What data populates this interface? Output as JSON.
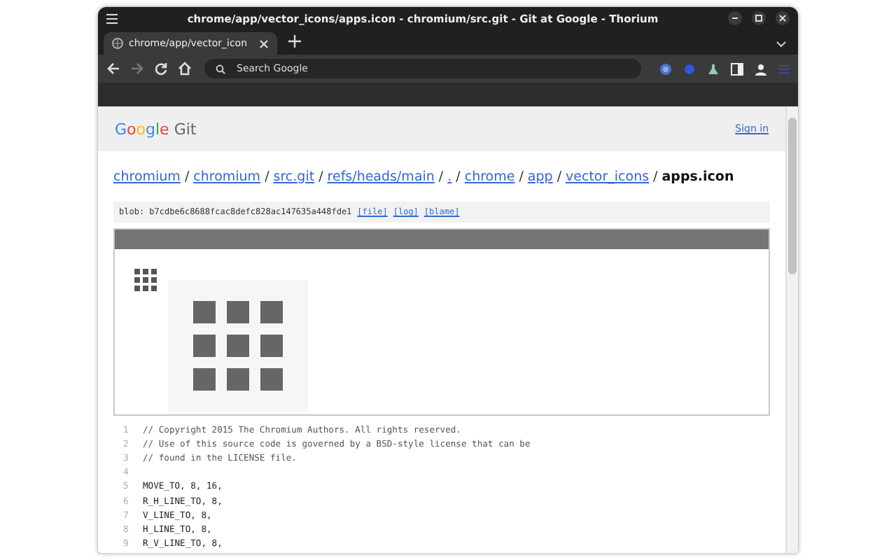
{
  "window": {
    "title": "chrome/app/vector_icons/apps.icon - chromium/src.git - Git at Google - Thorium"
  },
  "tabs": [
    {
      "label": "chrome/app/vector_icon",
      "selected": true
    }
  ],
  "nav_buttons": [
    {
      "kind": "back",
      "disabled": false
    },
    {
      "kind": "forward",
      "disabled": true
    },
    {
      "kind": "reload",
      "disabled": false
    },
    {
      "kind": "home",
      "disabled": false
    }
  ],
  "omnibox": {
    "placeholder": "Search Google"
  },
  "site": {
    "logo": "Google",
    "product": "Git",
    "sign_in": "Sign in"
  },
  "breadcrumb": [
    {
      "kind": "link",
      "label": "chromium"
    },
    {
      "kind": "separator",
      "label": "/"
    },
    {
      "kind": "link",
      "label": "chromium"
    },
    {
      "kind": "separator",
      "label": "/"
    },
    {
      "kind": "link",
      "label": "src.git"
    },
    {
      "kind": "separator",
      "label": "/"
    },
    {
      "kind": "link",
      "label": "refs/heads/main"
    },
    {
      "kind": "separator",
      "label": "/"
    },
    {
      "kind": "link",
      "label": "."
    },
    {
      "kind": "separator",
      "label": "/"
    },
    {
      "kind": "link",
      "label": "chrome"
    },
    {
      "kind": "separator",
      "label": "/"
    },
    {
      "kind": "link",
      "label": "app"
    },
    {
      "kind": "separator",
      "label": "/"
    },
    {
      "kind": "link",
      "label": "vector_icons"
    },
    {
      "kind": "separator",
      "label": "/"
    },
    {
      "kind": "current",
      "label": "apps.icon"
    }
  ],
  "blob": {
    "label": "blob: b7cdbe6c8688fcac8defc828ac147635a448fde1",
    "links": [
      "[file]",
      "[log]",
      "[blame]"
    ]
  },
  "code": [
    {
      "number": "1",
      "kind": "comment",
      "text": "// Copyright 2015 The Chromium Authors. All rights reserved."
    },
    {
      "number": "2",
      "kind": "comment",
      "text": "// Use of this source code is governed by a BSD-style license that can be"
    },
    {
      "number": "3",
      "kind": "comment",
      "text": "// found in the LICENSE file."
    },
    {
      "number": "4",
      "kind": "blank"
    },
    {
      "number": "5",
      "kind": "code",
      "text": "MOVE_TO, 8, 16,"
    },
    {
      "number": "6",
      "kind": "code",
      "text": "R_H_LINE_TO, 8,"
    },
    {
      "number": "7",
      "kind": "code",
      "text": "V_LINE_TO, 8,"
    },
    {
      "number": "8",
      "kind": "code",
      "text": "H_LINE_TO, 8,"
    },
    {
      "number": "9",
      "kind": "code",
      "text": "R_V_LINE_TO, 8,"
    }
  ]
}
